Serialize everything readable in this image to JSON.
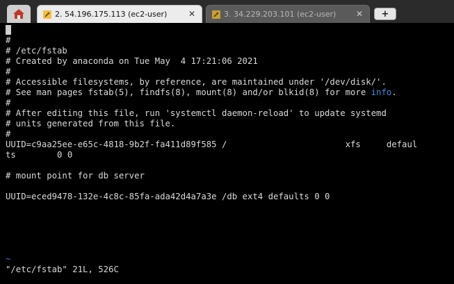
{
  "tabs": [
    {
      "label": "2. 54.196.175.113 (ec2-user)",
      "icon": "wrench-icon",
      "active": true
    },
    {
      "label": "3. 34.229.203.101 (ec2-user)",
      "icon": "wrench-icon",
      "active": false
    }
  ],
  "home_icon": "home-icon",
  "close_glyph": "✕",
  "new_tab_glyph": "+",
  "terminal": {
    "lines": [
      "#",
      "# /etc/fstab",
      "# Created by anaconda on Tue May  4 17:21:06 2021",
      "#",
      "# Accessible filesystems, by reference, are maintained under '/dev/disk/'.",
      "# See man pages fstab(5), findfs(8), mount(8) and/or blkid(8) for more ",
      "#",
      "# After editing this file, run 'systemctl daemon-reload' to update systemd",
      "# units generated from this file.",
      "#",
      "UUID=c9aa25ee-e65c-4818-9b2f-fa411d89f585 /                       xfs     defaul",
      "ts        0 0",
      "",
      "# mount point for db server",
      "",
      "UUID=eced9478-132e-4c8c-85fa-ada42d4a7a3e /db ext4 defaults 0 0"
    ],
    "info_word": "info",
    "info_suffix": ".",
    "tilde": "~",
    "status": "\"/etc/fstab\" 21L, 526C"
  },
  "colors": {
    "background": "#000000",
    "text": "#d9d9d9",
    "highlight": "#3d8fe0"
  }
}
